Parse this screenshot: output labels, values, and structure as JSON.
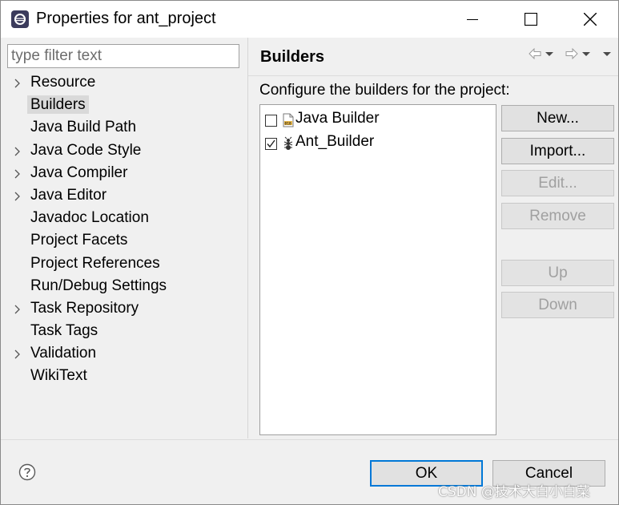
{
  "window": {
    "title": "Properties for ant_project"
  },
  "filter": {
    "placeholder": "type filter text",
    "value": ""
  },
  "tree": {
    "items": [
      {
        "label": "Resource",
        "expandable": true
      },
      {
        "label": "Builders",
        "expandable": false,
        "selected": true
      },
      {
        "label": "Java Build Path",
        "expandable": false
      },
      {
        "label": "Java Code Style",
        "expandable": true
      },
      {
        "label": "Java Compiler",
        "expandable": true
      },
      {
        "label": "Java Editor",
        "expandable": true
      },
      {
        "label": "Javadoc Location",
        "expandable": false
      },
      {
        "label": "Project Facets",
        "expandable": false
      },
      {
        "label": "Project References",
        "expandable": false
      },
      {
        "label": "Run/Debug Settings",
        "expandable": false
      },
      {
        "label": "Task Repository",
        "expandable": true
      },
      {
        "label": "Task Tags",
        "expandable": false
      },
      {
        "label": "Validation",
        "expandable": true
      },
      {
        "label": "WikiText",
        "expandable": false
      }
    ]
  },
  "page": {
    "title": "Builders",
    "description": "Configure the builders for the project:"
  },
  "builders": [
    {
      "label": "Java Builder",
      "checked": false,
      "icon": "java-builder-icon"
    },
    {
      "label": "Ant_Builder",
      "checked": true,
      "icon": "ant-builder-icon"
    }
  ],
  "buttons": {
    "new": "New...",
    "import": "Import...",
    "edit": "Edit...",
    "remove": "Remove",
    "up": "Up",
    "down": "Down",
    "ok": "OK",
    "cancel": "Cancel"
  },
  "watermark": "CSDN @技术大白小白菜",
  "colors": {
    "accent": "#0078d7",
    "selection": "#d9d9d9",
    "disabled_text": "#a0a0a0"
  }
}
